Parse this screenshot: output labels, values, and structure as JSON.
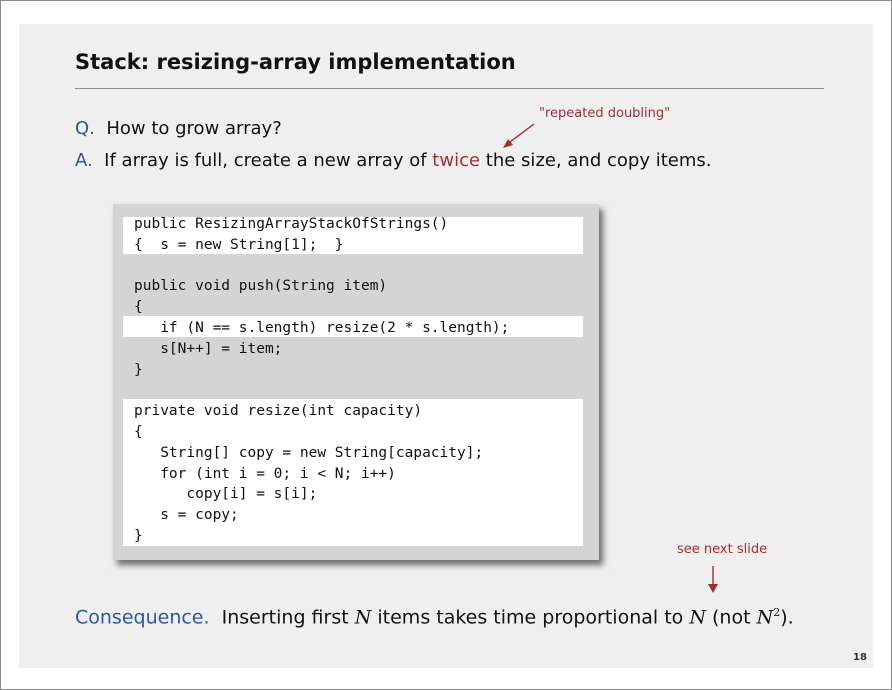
{
  "title": "Stack:  resizing-array implementation",
  "question": {
    "label": "Q.",
    "text": "How to grow array?"
  },
  "answer": {
    "label": "A.",
    "before": "If array is full, create a new array of",
    "highlight": "twice",
    "after": "the size, and copy items."
  },
  "notes": {
    "repeated_doubling": "\"repeated doubling\"",
    "see_next": "see next slide"
  },
  "code_lines": [
    "public ResizingArrayStackOfStrings()",
    "{  s = new String[1];  }",
    "",
    "public void push(String item)",
    "{",
    "   if (N == s.length) resize(2 * s.length);",
    "   s[N++] = item;",
    "}",
    "",
    "private void resize(int capacity)",
    "{",
    "   String[] copy = new String[capacity];",
    "   for (int i = 0; i < N; i++)",
    "      copy[i] = s[i];",
    "   s = copy;",
    "}"
  ],
  "consequence": {
    "label": "Consequence.",
    "text1": "Inserting first",
    "n1": "N",
    "text2": "items takes time proportional to",
    "n2": "N",
    "text3": "(not",
    "n3": "N",
    "exp": "2",
    "text4": ")."
  },
  "page_number": "18",
  "colors": {
    "accent_blue": "#2a57a0",
    "accent_red": "#9e2f2f",
    "code_box": "#d4d4d4"
  }
}
